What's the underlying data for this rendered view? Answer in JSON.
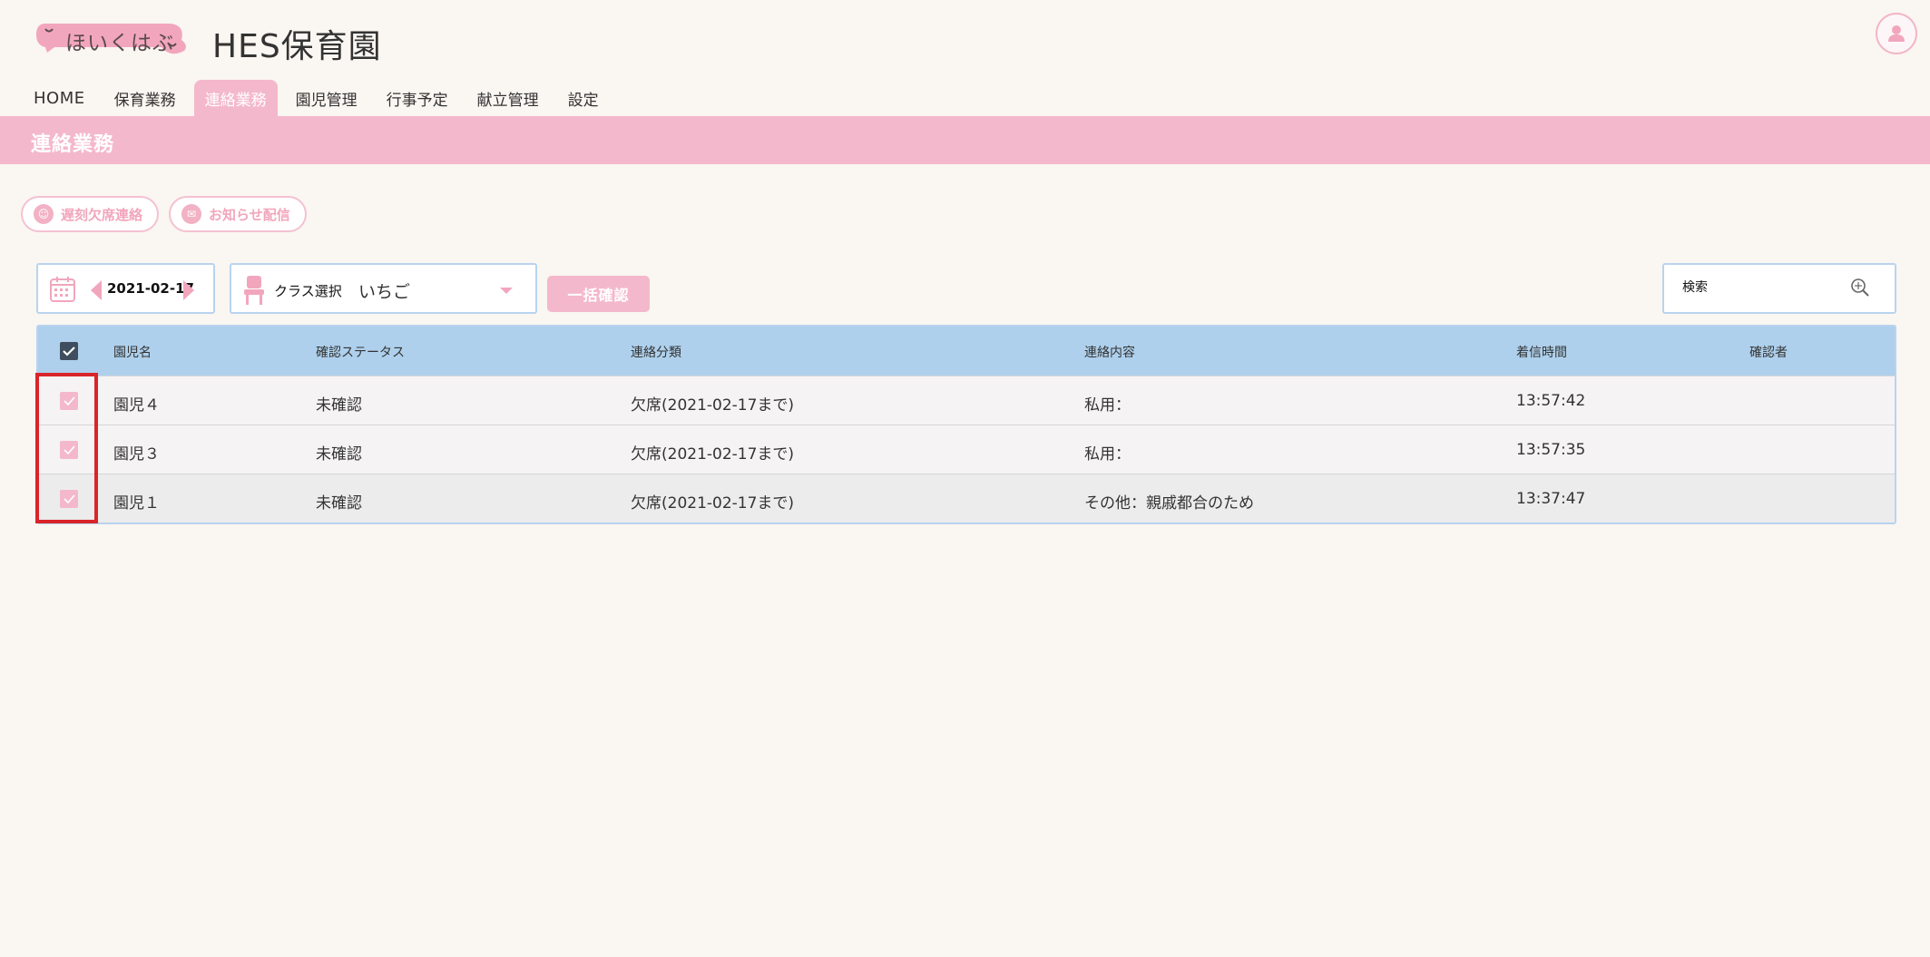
{
  "header": {
    "logo_text": "ほいくはぶ",
    "school_name": "HES保育園"
  },
  "nav": {
    "tabs": [
      {
        "label": "HOME",
        "active": false
      },
      {
        "label": "保育業務",
        "active": false
      },
      {
        "label": "連絡業務",
        "active": true
      },
      {
        "label": "園児管理",
        "active": false
      },
      {
        "label": "行事予定",
        "active": false
      },
      {
        "label": "献立管理",
        "active": false
      },
      {
        "label": "設定",
        "active": false
      }
    ]
  },
  "section": {
    "title": "連絡業務"
  },
  "actions": {
    "absence_label": "遅刻欠席連絡",
    "notice_label": "お知らせ配信"
  },
  "filters": {
    "date": "2021-02-17",
    "class_label": "クラス選択",
    "class_value": "いちご",
    "bulk_confirm_label": "一括確認",
    "search_placeholder": "検索"
  },
  "table": {
    "columns": [
      "園児名",
      "確認ステータス",
      "連絡分類",
      "連絡内容",
      "着信時間",
      "確認者"
    ],
    "rows": [
      {
        "name": "園児４",
        "status": "未確認",
        "type": "欠席(2021-02-17まで)",
        "content": "私用：",
        "time": "13:57:42",
        "confirmer": "",
        "checked": true
      },
      {
        "name": "園児３",
        "status": "未確認",
        "type": "欠席(2021-02-17まで)",
        "content": "私用：",
        "time": "13:57:35",
        "confirmer": "",
        "checked": true
      },
      {
        "name": "園児１",
        "status": "未確認",
        "type": "欠席(2021-02-17まで)",
        "content": "その他：親戚都合のため",
        "time": "13:37:47",
        "confirmer": "",
        "checked": true
      }
    ]
  },
  "colors": {
    "accent_pink": "#f4b8cc",
    "header_blue": "#aed0ec",
    "highlight_red": "#d9252a"
  }
}
